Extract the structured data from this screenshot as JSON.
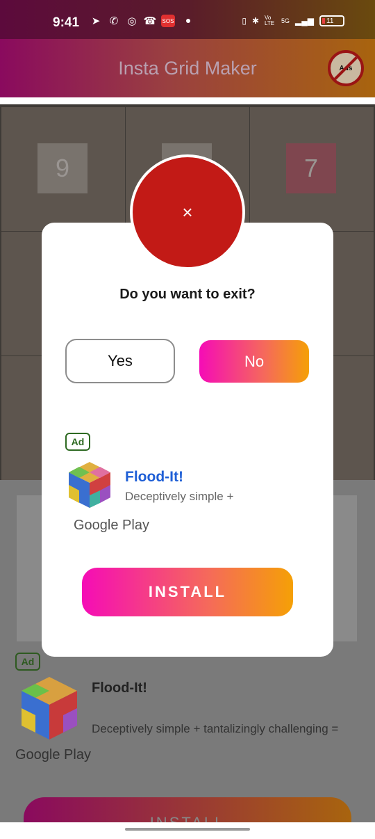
{
  "status_bar": {
    "time": "9:41",
    "network": "5G",
    "volte": "Vo LTE",
    "battery": "11",
    "sos": "SOS"
  },
  "app_bar": {
    "title": "Insta Grid Maker",
    "no_ads_label": "Ads"
  },
  "grid": {
    "numbers": [
      "9",
      "7"
    ]
  },
  "background_ad": {
    "badge": "Ad",
    "app_name": "Flood-It!",
    "description": "Deceptively simple + tantalizingly challenging =",
    "store": "Google Play",
    "install_label": "INSTALL"
  },
  "dialog": {
    "close_symbol": "×",
    "question": "Do you want to exit?",
    "yes_label": "Yes",
    "no_label": "No",
    "ad": {
      "badge": "Ad",
      "app_name": "Flood-It!",
      "description": "Deceptively simple +",
      "store": "Google Play",
      "install_label": "INSTALL"
    }
  },
  "colors": {
    "accent_gradient_start": "#f50cb6",
    "accent_gradient_end": "#f5a006",
    "close_red": "#c21a16",
    "ad_green": "#2e6a22",
    "app_name_blue": "#1f5fd6"
  }
}
